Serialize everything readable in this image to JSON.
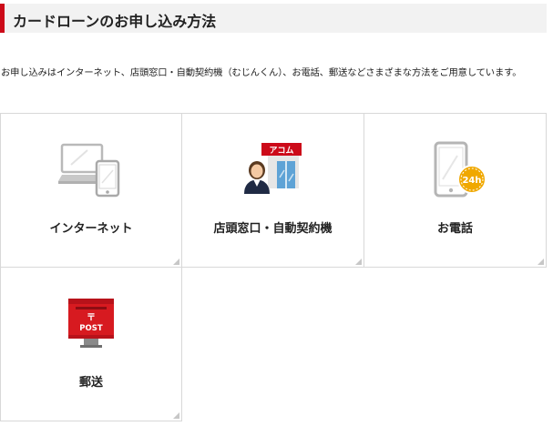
{
  "header": {
    "title": "カードローンのお申し込み方法"
  },
  "intro": {
    "text": "お申し込みはインターネット、店頭窓口・自動契約機（むじんくん）、お電話、郵送などさまざまな方法をご用意しています。"
  },
  "methods": [
    {
      "label": "インターネット",
      "icon": "laptop-smartphone-icon"
    },
    {
      "label": "店頭窓口・自動契約機",
      "icon": "store-staff-icon",
      "sign_text": "アコム"
    },
    {
      "label": "お電話",
      "icon": "phone-24h-icon",
      "badge_text": "24h"
    },
    {
      "label": "郵送",
      "icon": "postbox-icon",
      "mark_text": "〒",
      "box_text": "POST"
    }
  ],
  "colors": {
    "accent": "#cc0a19",
    "header_bg": "#f2f2f2",
    "border": "#d8d8d8",
    "badge": "#f0a800",
    "icon_gray": "#b9b9b9"
  }
}
